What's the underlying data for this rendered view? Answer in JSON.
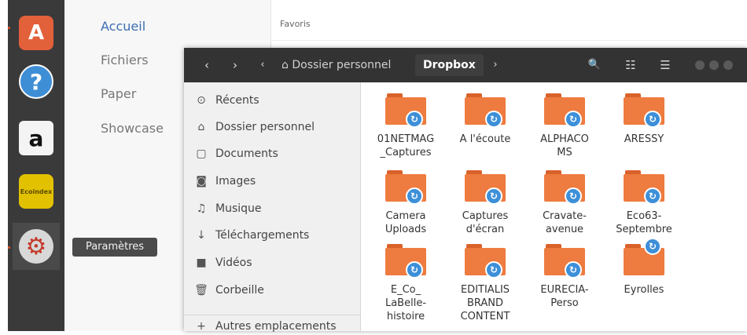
{
  "launcher": {
    "items": [
      {
        "name": "software-center",
        "glyph": "A",
        "active": false,
        "running": true
      },
      {
        "name": "help",
        "glyph": "?",
        "active": false,
        "running": false
      },
      {
        "name": "amazon",
        "glyph": "a",
        "active": false,
        "running": false
      },
      {
        "name": "ecoindex",
        "glyph": "Ecoindex",
        "active": false,
        "running": false
      },
      {
        "name": "settings",
        "glyph": "⚙",
        "active": true,
        "running": true
      }
    ],
    "tooltip": "Paramètres"
  },
  "software_center": {
    "nav": [
      "Accueil",
      "Fichiers",
      "Paper",
      "Showcase"
    ],
    "section_title": "Favoris"
  },
  "files_window": {
    "back": "‹",
    "forward": "›",
    "crumb_left_arrow": "‹",
    "crumb_home": "Dossier personnel",
    "crumb_current": "Dropbox",
    "crumb_right_arrow": "›",
    "search_icon": "🔍",
    "view_icon": "☷",
    "menu_icon": "☰",
    "sidebar": [
      {
        "icon": "⊙",
        "label": "Récents"
      },
      {
        "icon": "⌂",
        "label": "Dossier personnel"
      },
      {
        "icon": "▢",
        "label": "Documents"
      },
      {
        "icon": "◙",
        "label": "Images"
      },
      {
        "icon": "♫",
        "label": "Musique"
      },
      {
        "icon": "↓",
        "label": "Téléchargements"
      },
      {
        "icon": "■",
        "label": "Vidéos"
      },
      {
        "icon": "🗑",
        "label": "Corbeille"
      },
      {
        "icon": "+",
        "label": "Autres emplacements"
      }
    ],
    "files": [
      {
        "label": "01NETMAG\n_Captures",
        "special": false
      },
      {
        "label": "A l'écoute",
        "special": false
      },
      {
        "label": "ALPHACO\nMS",
        "special": false
      },
      {
        "label": "ARESSY",
        "special": false
      },
      {
        "label": "Camera\nUploads",
        "special": false
      },
      {
        "label": "Captures\nd'écran",
        "special": false
      },
      {
        "label": "Cravate-\navenue",
        "special": false
      },
      {
        "label": "Eco63-\nSeptembre",
        "special": false
      },
      {
        "label": "E_Co_\nLaBelle-\nhistoire",
        "special": false
      },
      {
        "label": "EDITIALIS\nBRAND\nCONTENT",
        "special": false
      },
      {
        "label": "EURECIA-\nPerso",
        "special": false
      },
      {
        "label": "Eyrolles",
        "special": true
      }
    ]
  },
  "colors": {
    "accent_orange": "#e95420",
    "folder_orange": "#ee7b3f",
    "sync_blue": "#3d8fd8",
    "headerbar": "#333333"
  }
}
